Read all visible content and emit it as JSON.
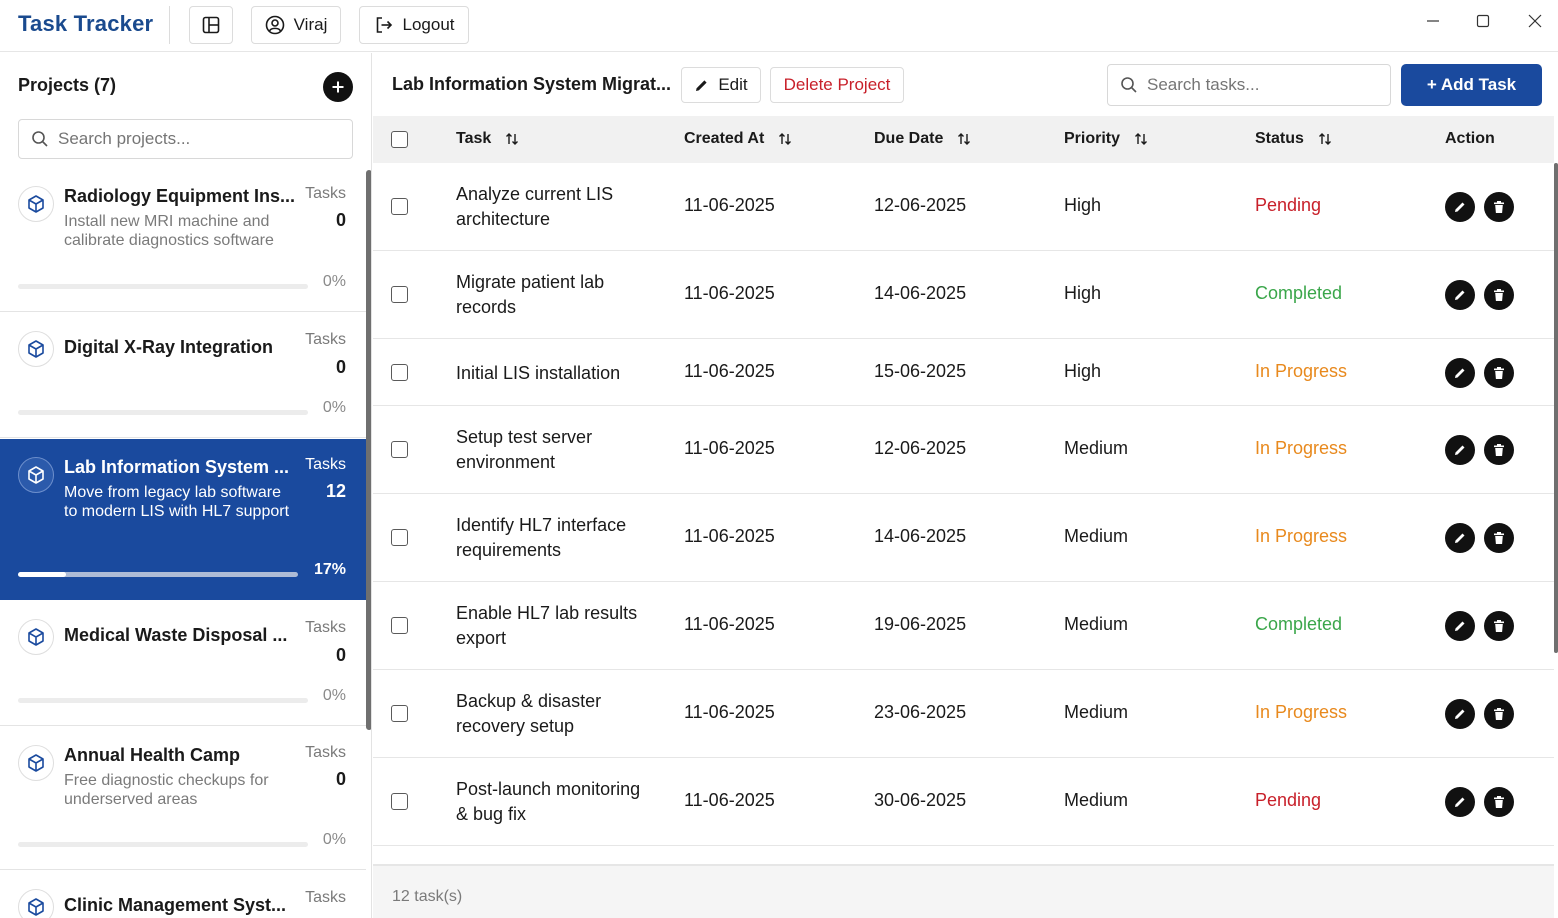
{
  "app": {
    "title": "Task Tracker",
    "user_label": "Viraj",
    "logout_label": "Logout"
  },
  "sidebar": {
    "heading": "Projects (7)",
    "search_placeholder": "Search projects...",
    "tasks_label": "Tasks",
    "projects": [
      {
        "name": "Radiology Equipment Ins...",
        "description": "Install new MRI machine and calibrate diagnostics software",
        "tasks": "0",
        "progress_text": "0%",
        "progress_fraction": 0,
        "active": false
      },
      {
        "name": "Digital X-Ray Integration",
        "description": "",
        "tasks": "0",
        "progress_text": "0%",
        "progress_fraction": 0,
        "active": false
      },
      {
        "name": "Lab Information System ...",
        "description": "Move from legacy lab software to modern LIS with HL7 support",
        "tasks": "12",
        "progress_text": "17%",
        "progress_fraction": 0.17,
        "active": true
      },
      {
        "name": "Medical Waste Disposal ...",
        "description": "",
        "tasks": "0",
        "progress_text": "0%",
        "progress_fraction": 0,
        "active": false
      },
      {
        "name": "Annual Health Camp",
        "description": "Free diagnostic checkups for underserved areas",
        "tasks": "0",
        "progress_text": "0%",
        "progress_fraction": 0,
        "active": false
      },
      {
        "name": "Clinic Management Syst...",
        "description": "",
        "tasks": "",
        "progress_text": "",
        "progress_fraction": 0,
        "active": false
      }
    ]
  },
  "main": {
    "project_title": "Lab Information System Migrat...",
    "edit_label": "Edit",
    "delete_label": "Delete Project",
    "search_placeholder": "Search tasks...",
    "add_task_label": "+ Add Task",
    "columns": {
      "task": "Task",
      "created": "Created At",
      "due": "Due Date",
      "priority": "Priority",
      "status": "Status",
      "action": "Action"
    },
    "status_colors": {
      "Pending": "#c8202a",
      "Completed": "#3aa64a",
      "In Progress": "#e8891d"
    },
    "tasks": [
      {
        "task": "Analyze current LIS architecture",
        "created": "11-06-2025",
        "due": "12-06-2025",
        "priority": "High",
        "status": "Pending"
      },
      {
        "task": "Migrate patient lab records",
        "created": "11-06-2025",
        "due": "14-06-2025",
        "priority": "High",
        "status": "Completed"
      },
      {
        "task": "Initial LIS installation",
        "created": "11-06-2025",
        "due": "15-06-2025",
        "priority": "High",
        "status": "In Progress"
      },
      {
        "task": "Setup test server environment",
        "created": "11-06-2025",
        "due": "12-06-2025",
        "priority": "Medium",
        "status": "In Progress"
      },
      {
        "task": "Identify HL7 interface requirements",
        "created": "11-06-2025",
        "due": "14-06-2025",
        "priority": "Medium",
        "status": "In Progress"
      },
      {
        "task": "Enable HL7 lab results export",
        "created": "11-06-2025",
        "due": "19-06-2025",
        "priority": "Medium",
        "status": "Completed"
      },
      {
        "task": "Backup & disaster recovery setup",
        "created": "11-06-2025",
        "due": "23-06-2025",
        "priority": "Medium",
        "status": "In Progress"
      },
      {
        "task": "Post-launch monitoring & bug fix",
        "created": "11-06-2025",
        "due": "30-06-2025",
        "priority": "Medium",
        "status": "Pending"
      }
    ],
    "footer_count": "12 task(s)"
  }
}
